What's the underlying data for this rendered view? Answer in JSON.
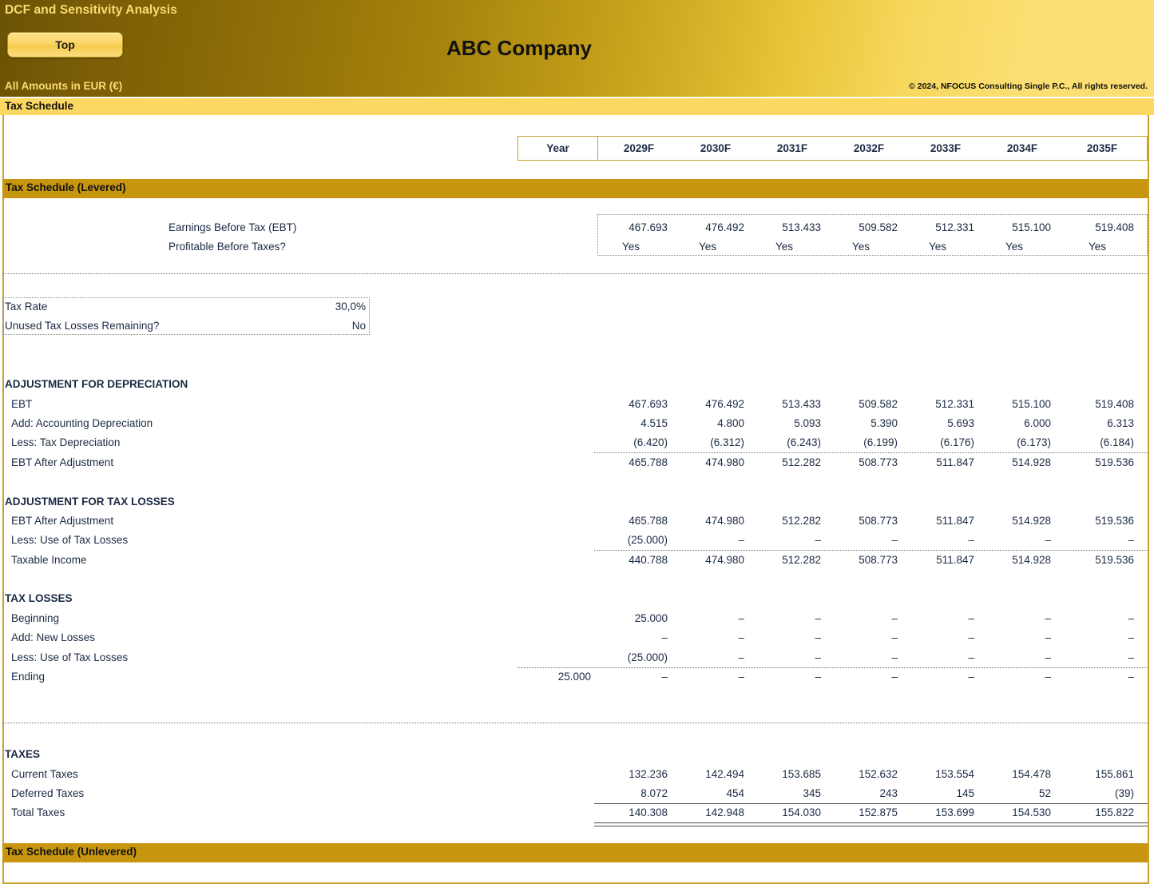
{
  "banner": {
    "app_title": "DCF and Sensitivity Analysis",
    "top_button": "Top",
    "currency_note": "All Amounts in  EUR (€)",
    "company_name": "ABC Company",
    "copyright": "© 2024, NFOCUS Consulting Single P.C., All rights reserved."
  },
  "sheet": {
    "title": "Tax Schedule"
  },
  "table": {
    "year_label": "Year",
    "years": [
      "2029F",
      "2030F",
      "2031F",
      "2032F",
      "2033F",
      "2034F",
      "2035F"
    ]
  },
  "sections": {
    "levered_band": "Tax Schedule (Levered)",
    "unlevered_band": "Tax Schedule (Unlevered)",
    "adj_depreciation": "ADJUSTMENT FOR DEPRECIATION",
    "adj_tax_losses": "ADJUSTMENT FOR TAX LOSSES",
    "tax_losses": "TAX LOSSES",
    "taxes": "TAXES"
  },
  "summary": {
    "ebt_label": "Earnings Before Tax (EBT)",
    "ebt_values": [
      "467.693",
      "476.492",
      "513.433",
      "509.582",
      "512.331",
      "515.100",
      "519.408"
    ],
    "profitable_label": "Profitable Before Taxes?",
    "profitable_values": [
      "Yes",
      "Yes",
      "Yes",
      "Yes",
      "Yes",
      "Yes",
      "Yes"
    ]
  },
  "assumptions": {
    "tax_rate_label": "Tax Rate",
    "tax_rate_value": "30,0%",
    "unused_losses_label": "Unused Tax Losses Remaining?",
    "unused_losses_value": "No"
  },
  "depreciation_rows": [
    {
      "label": "EBT",
      "values": [
        "467.693",
        "476.492",
        "513.433",
        "509.582",
        "512.331",
        "515.100",
        "519.408"
      ]
    },
    {
      "label": "Add: Accounting Depreciation",
      "values": [
        "4.515",
        "4.800",
        "5.093",
        "5.390",
        "5.693",
        "6.000",
        "6.313"
      ]
    },
    {
      "label": "Less: Tax Depreciation",
      "values": [
        "(6.420)",
        "(6.312)",
        "(6.243)",
        "(6.199)",
        "(6.176)",
        "(6.173)",
        "(6.184)"
      ]
    },
    {
      "label": "EBT After Adjustment",
      "values": [
        "465.788",
        "474.980",
        "512.282",
        "508.773",
        "511.847",
        "514.928",
        "519.536"
      ]
    }
  ],
  "tax_loss_adj_rows": [
    {
      "label": "EBT After Adjustment",
      "values": [
        "465.788",
        "474.980",
        "512.282",
        "508.773",
        "511.847",
        "514.928",
        "519.536"
      ]
    },
    {
      "label": "Less: Use of Tax Losses",
      "values": [
        "(25.000)",
        "–",
        "–",
        "–",
        "–",
        "–",
        "–"
      ]
    },
    {
      "label": "Taxable Income",
      "values": [
        "440.788",
        "474.980",
        "512.282",
        "508.773",
        "511.847",
        "514.928",
        "519.536"
      ]
    }
  ],
  "tax_losses_rows": [
    {
      "label": "Beginning",
      "prior": "",
      "values": [
        "25.000",
        "–",
        "–",
        "–",
        "–",
        "–",
        "–"
      ]
    },
    {
      "label": "Add: New Losses",
      "prior": "",
      "values": [
        "–",
        "–",
        "–",
        "–",
        "–",
        "–",
        "–"
      ]
    },
    {
      "label": "Less: Use of Tax Losses",
      "prior": "",
      "values": [
        "(25.000)",
        "–",
        "–",
        "–",
        "–",
        "–",
        "–"
      ]
    },
    {
      "label": "Ending",
      "prior": "25.000",
      "values": [
        "–",
        "–",
        "–",
        "–",
        "–",
        "–",
        "–"
      ]
    }
  ],
  "taxes_rows": [
    {
      "label": "Current Taxes",
      "values": [
        "132.236",
        "142.494",
        "153.685",
        "152.632",
        "153.554",
        "154.478",
        "155.861"
      ]
    },
    {
      "label": "Deferred Taxes",
      "values": [
        "8.072",
        "454",
        "345",
        "243",
        "145",
        "52",
        "(39)"
      ]
    },
    {
      "label": "Total Taxes",
      "values": [
        "140.308",
        "142.948",
        "154.030",
        "152.875",
        "153.699",
        "154.530",
        "155.822"
      ]
    }
  ],
  "colors": {
    "band_gold": "#c8960d",
    "title_gold": "#fbd862",
    "accent_text": "#f9dd72",
    "frame": "#c8a12c",
    "text": "#1b2a44"
  }
}
